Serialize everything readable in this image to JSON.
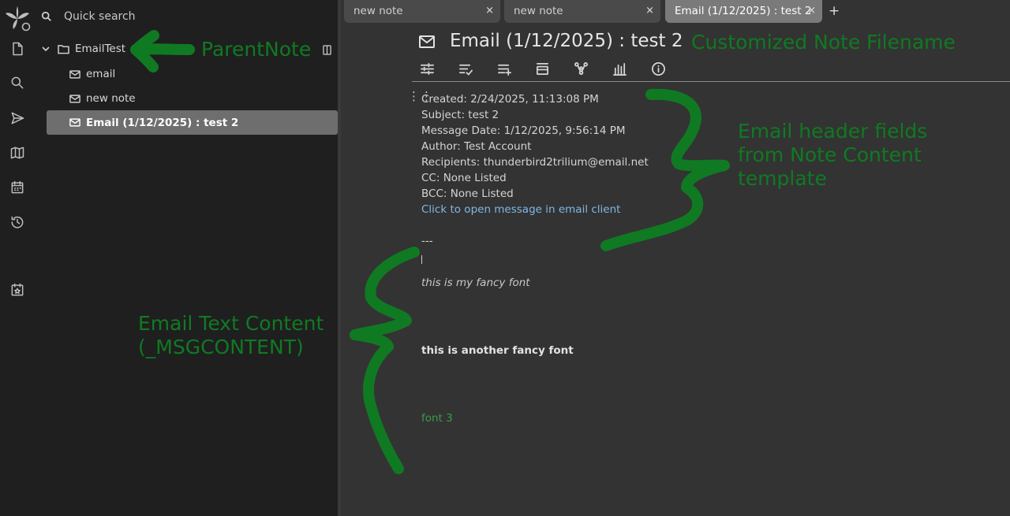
{
  "sidebar": {
    "quick_search": "Quick search",
    "launcher_icons": [
      "trilium-logo-icon",
      "new-note-icon",
      "search-icon",
      "send-icon",
      "map-icon",
      "calendar-icon",
      "history-icon",
      "bookmark-calendar-icon"
    ]
  },
  "tree": {
    "parent": {
      "label": "EmailTest",
      "icon": "folder-icon",
      "expanded": true
    },
    "items": [
      {
        "label": "email",
        "icon": "mail-icon"
      },
      {
        "label": "new note",
        "icon": "mail-icon"
      },
      {
        "label": "Email (1/12/2025) : test 2",
        "icon": "mail-icon",
        "active": true
      }
    ]
  },
  "tabs": [
    {
      "label": "new note",
      "close": "×"
    },
    {
      "label": "new note",
      "close": "×"
    },
    {
      "label": "Email (1/12/2025) : test 2",
      "close": "×",
      "active": true
    }
  ],
  "tab_add": "+",
  "note": {
    "title": "Email (1/12/2025) : test 2",
    "toolbar_icons": [
      "settings-sliders-icon",
      "list-check-icon",
      "list-add-icon",
      "collapse-icon",
      "graph-icon",
      "bar-chart-icon",
      "info-icon"
    ],
    "lines": {
      "created": "Created: 2/24/2025, 11:13:08 PM",
      "subject": "Subject: test 2",
      "message_date": "Message Date: 1/12/2025, 9:56:14 PM",
      "author": "Author: Test Account",
      "recipients": "Recipients: thunderbird2trilium@email.net",
      "cc": "CC: None Listed",
      "bcc": "BCC: None Listed",
      "link": "Click to open message in email client",
      "separator": "---",
      "fancy1": "this is my fancy font",
      "fancy2": "this is another fancy font",
      "font3": "font 3"
    }
  },
  "annotations": {
    "parent_note": "ParentNote",
    "filename": "Customized Note Filename",
    "header_fields_1": "Email header fields",
    "header_fields_2": "from Note Content",
    "header_fields_3": "template",
    "text_content_1": "Email Text Content",
    "text_content_2": "(_MSGCONTENT)"
  },
  "colors": {
    "annotation_green": "#0f7a22",
    "link_blue": "#7fb8e6",
    "font3_green": "#3c9a4b",
    "active_tree_bg": "#6e6e6e"
  }
}
